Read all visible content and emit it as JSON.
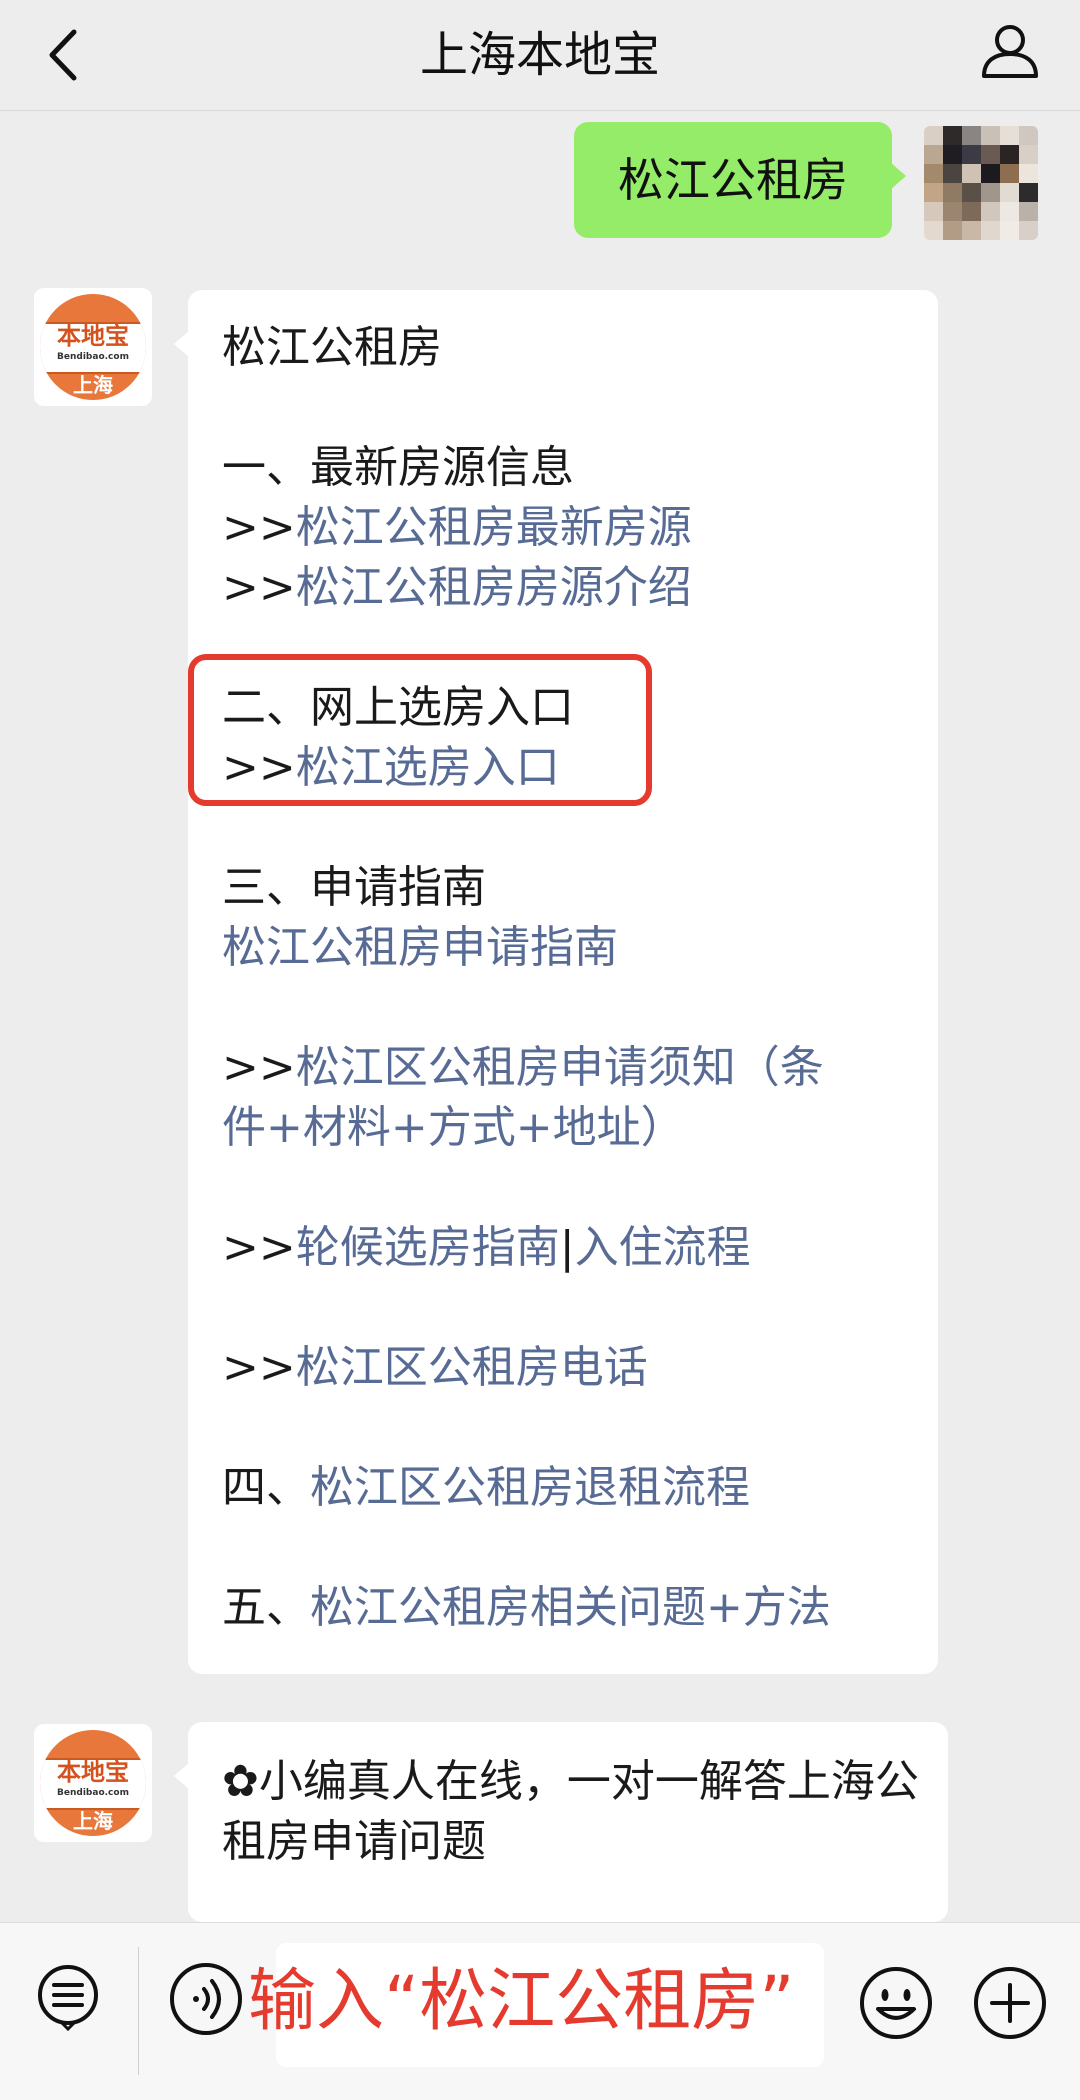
{
  "header": {
    "title": "上海本地宝",
    "back_icon": "chevron-left-icon",
    "profile_icon": "person-icon"
  },
  "sent_message": {
    "text": "松江公租房"
  },
  "bot": {
    "brand": "本地宝",
    "domain": "Bendibao.com",
    "city": "上海"
  },
  "reply": {
    "heading": "松江公租房",
    "sections": [
      {
        "title": "一、最新房源信息",
        "links": [
          {
            "prefix": ">>",
            "text": "松江公租房最新房源"
          },
          {
            "prefix": ">>",
            "text": "松江公租房房源介绍"
          }
        ]
      },
      {
        "title": "二、网上选房入口",
        "links": [
          {
            "prefix": ">>",
            "text": "松江选房入口"
          }
        ]
      },
      {
        "title": "三、申请指南",
        "guide_link": "松江公租房申请指南",
        "links": [
          {
            "prefix": ">>",
            "text_line1": "松江区公租房申请须知（条",
            "text_line2": "件+材料+方式+地址）"
          },
          {
            "prefix": ">>",
            "text_a": "轮候选房指南",
            "separator": "|",
            "text_b": "入住流程"
          },
          {
            "prefix": ">>",
            "text": "松江区公租房电话"
          }
        ]
      },
      {
        "title": "四、",
        "link": "松江区公租房退租流程"
      },
      {
        "title": "五、",
        "link": "松江公租房相关问题+方法"
      }
    ]
  },
  "reply2": {
    "text": "✿小编真人在线，一对一解答上海公租房申请问题"
  },
  "input_bar": {
    "caption": "输入“松江公租房”",
    "icons": [
      "menu-list-icon",
      "voice-icon",
      "emoji-icon",
      "plus-icon"
    ]
  },
  "colors": {
    "background": "#ededed",
    "sent_bubble": "#95ec69",
    "link": "#576b95",
    "highlight": "#e53a2e",
    "brand_orange": "#e8773c"
  }
}
